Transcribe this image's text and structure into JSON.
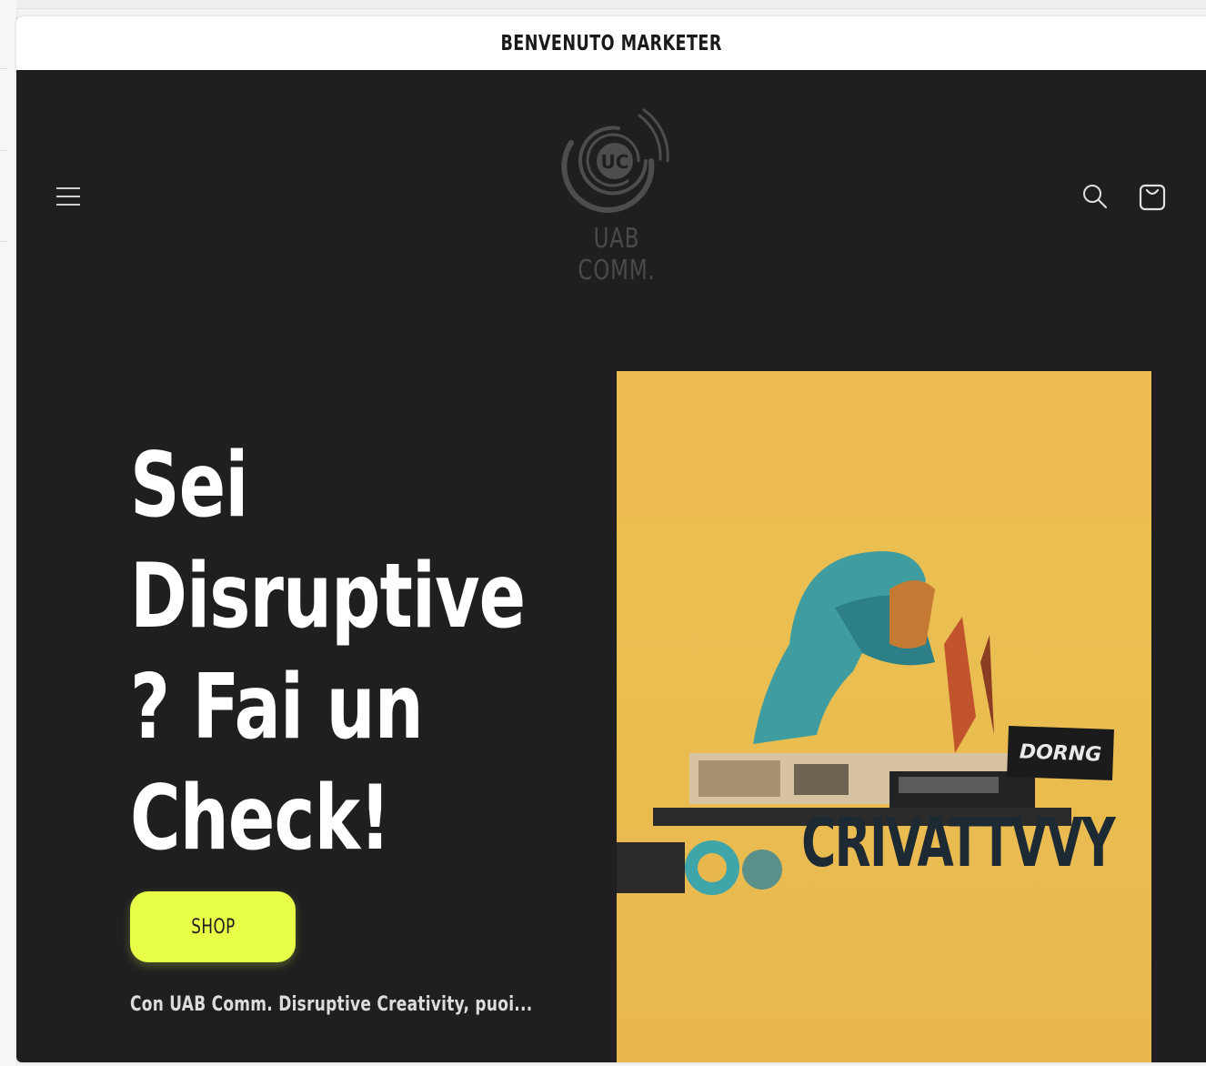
{
  "announcement": {
    "text": "BENVENUTO MARKETER"
  },
  "header": {
    "logo_text": "UAB COMM.",
    "logo_monogram": "UC",
    "icons": {
      "menu": "hamburger-icon",
      "search": "search-icon",
      "cart": "cart-icon"
    }
  },
  "hero": {
    "title": "Sei Disruptive ? Fai un Check!",
    "button_label": "SHOP",
    "description": "Con UAB Comm. Disruptive Creativity, puoi...",
    "image": {
      "caption_text": "CRIVATTVVY",
      "sign_text": "DORNG"
    }
  },
  "colors": {
    "background": "#1f1f21",
    "accent": "#e8ff47",
    "image_bg": "#eab84f",
    "announcement_bg": "#ffffff"
  }
}
